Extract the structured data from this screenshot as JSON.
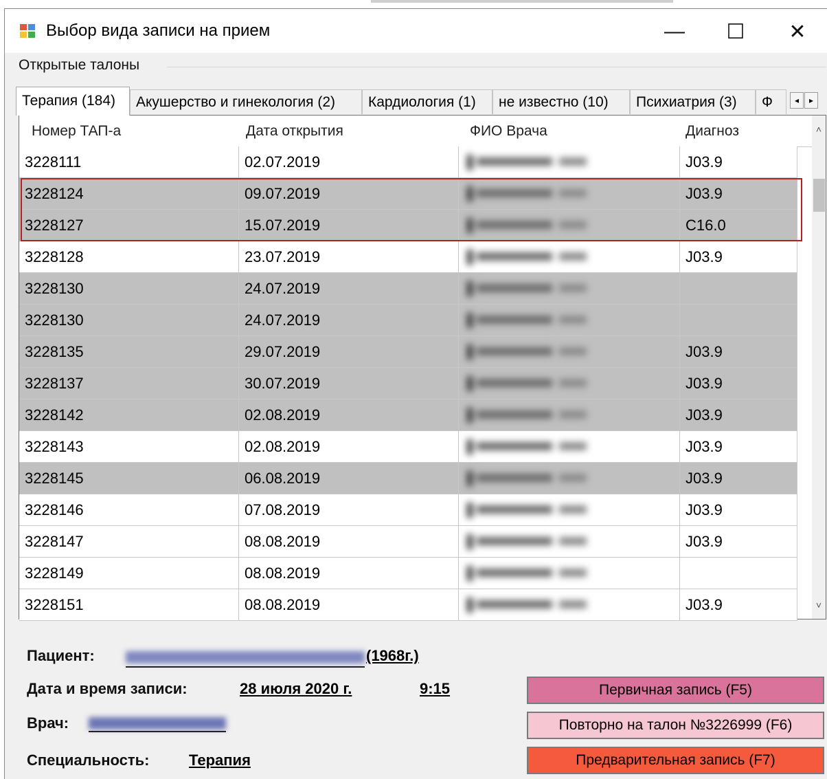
{
  "window": {
    "title": "Выбор вида записи на прием",
    "minimize_glyph": "—",
    "maximize_glyph": "☐",
    "close_glyph": "✕",
    "icon": "app-window-icon"
  },
  "section": {
    "label": "Открытые талоны"
  },
  "tabs": [
    {
      "label": "Терапия (184)",
      "active": true
    },
    {
      "label": "Акушерство и гинекология (2)",
      "active": false
    },
    {
      "label": "Кардиология (1)",
      "active": false
    },
    {
      "label": "не известно (10)",
      "active": false
    },
    {
      "label": "Психиатрия (3)",
      "active": false
    },
    {
      "label": "Ф",
      "active": false
    }
  ],
  "tab_scroll": {
    "left": "◂",
    "right": "▸"
  },
  "table": {
    "headers": [
      "Номер ТАП-а",
      "Дата открытия",
      "ФИО Врача",
      "Диагноз"
    ],
    "rows": [
      {
        "num": "3228111",
        "date": "02.07.2019",
        "diag": "J03.9",
        "shade": "white"
      },
      {
        "num": "3228124",
        "date": "09.07.2019",
        "diag": "J03.9",
        "shade": "gray"
      },
      {
        "num": "3228127",
        "date": "15.07.2019",
        "diag": "C16.0",
        "shade": "gray"
      },
      {
        "num": "3228128",
        "date": "23.07.2019",
        "diag": "J03.9",
        "shade": "white"
      },
      {
        "num": "3228130",
        "date": "24.07.2019",
        "diag": "",
        "shade": "gray"
      },
      {
        "num": "3228130",
        "date": "24.07.2019",
        "diag": "",
        "shade": "gray"
      },
      {
        "num": "3228135",
        "date": "29.07.2019",
        "diag": "J03.9",
        "shade": "gray"
      },
      {
        "num": "3228137",
        "date": "30.07.2019",
        "diag": "J03.9",
        "shade": "gray"
      },
      {
        "num": "3228142",
        "date": "02.08.2019",
        "diag": "J03.9",
        "shade": "gray"
      },
      {
        "num": "3228143",
        "date": "02.08.2019",
        "diag": "J03.9",
        "shade": "white"
      },
      {
        "num": "3228145",
        "date": "06.08.2019",
        "diag": "J03.9",
        "shade": "gray"
      },
      {
        "num": "3228146",
        "date": "07.08.2019",
        "diag": "J03.9",
        "shade": "white"
      },
      {
        "num": "3228147",
        "date": "08.08.2019",
        "diag": "J03.9",
        "shade": "white"
      },
      {
        "num": "3228149",
        "date": "08.08.2019",
        "diag": "",
        "shade": "white"
      },
      {
        "num": "3228151",
        "date": "08.08.2019",
        "diag": "J03.9",
        "shade": "white"
      }
    ],
    "scroll_up": "˄",
    "scroll_down": "˅"
  },
  "patient": {
    "label": "Пациент:",
    "birth_year": "(1968г.)",
    "datetime_label": "Дата и время записи:",
    "date": "28 июля 2020 г.",
    "time": "9:15",
    "doctor_label": "Врач:",
    "specialty_label": "Специальность:",
    "specialty": "Терапия"
  },
  "buttons": {
    "primary": "Первичная запись (F5)",
    "repeat": "Повторно на талон №3226999 (F6)",
    "preliminary": "Предварительная запись (F7)"
  },
  "colors": {
    "row_gray": "#c0c0c0",
    "selection_border": "#b22222",
    "btn_primary": "#d9739b",
    "btn_repeat": "#f7c6d3",
    "btn_preliminary": "#f55a3c"
  }
}
